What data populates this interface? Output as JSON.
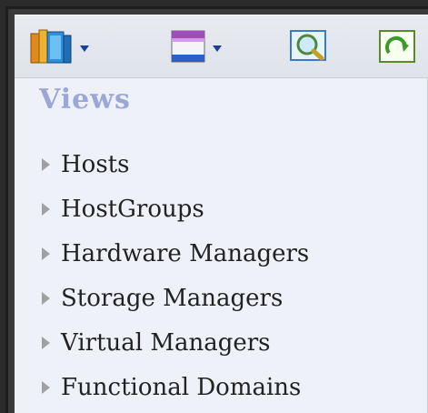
{
  "toolbar": {
    "buttons": [
      {
        "name": "library-books-icon",
        "has_dropdown": true
      },
      {
        "name": "window-layout-icon",
        "has_dropdown": true
      },
      {
        "name": "search-icon",
        "has_dropdown": false
      },
      {
        "name": "refresh-icon",
        "has_dropdown": false
      }
    ]
  },
  "panel": {
    "title": "Views",
    "items": [
      {
        "label": "Hosts"
      },
      {
        "label": "HostGroups"
      },
      {
        "label": "Hardware Managers"
      },
      {
        "label": "Storage Managers"
      },
      {
        "label": "Virtual Managers"
      },
      {
        "label": "Functional Domains"
      }
    ]
  },
  "colors": {
    "title": "#9aa8d6",
    "panel_bg": "#eef1f7",
    "arrow": "#a0a0a0",
    "frame": "#2b2b2b"
  }
}
